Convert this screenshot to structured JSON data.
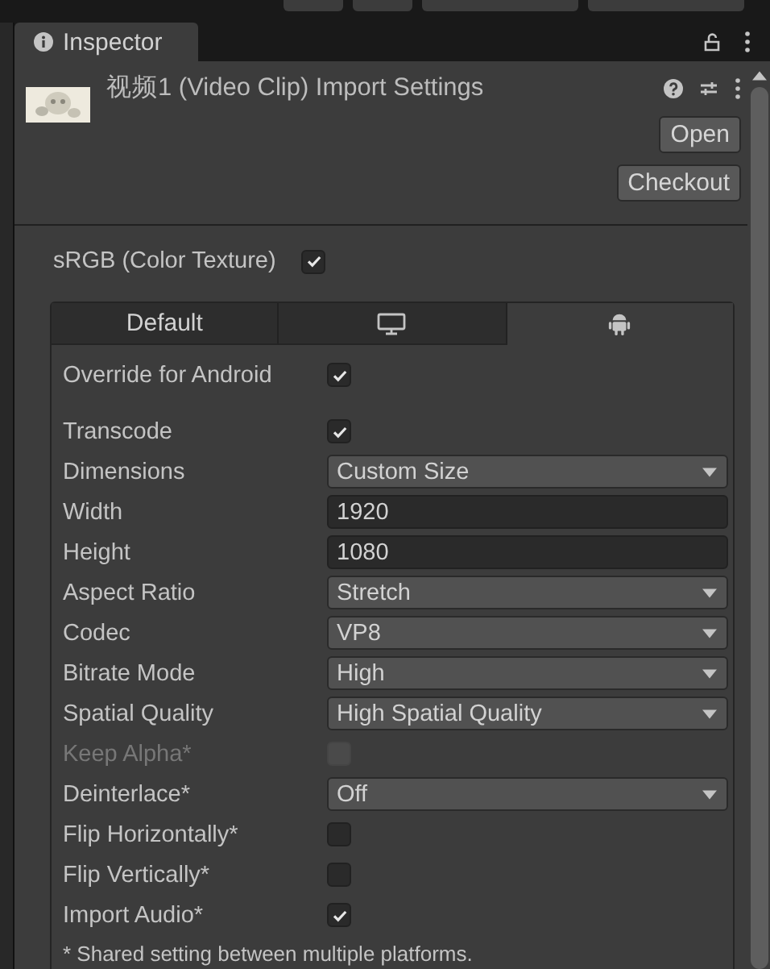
{
  "window": {
    "title": "Inspector"
  },
  "header": {
    "title": "视频1 (Video Clip) Import Settings",
    "thumbnail": {
      "kind": "picture"
    },
    "buttons": [
      "Open",
      "Checkout"
    ]
  },
  "srgb": {
    "label": "sRGB (Color Texture)",
    "checked": true
  },
  "platform_tabs": [
    {
      "kind": "text",
      "label": "Default",
      "selected": false
    },
    {
      "kind": "monitor",
      "selected": false
    },
    {
      "kind": "android",
      "selected": true
    }
  ],
  "override": {
    "label": "Override for Android",
    "checked": true
  },
  "settings": [
    {
      "kind": "checkbox",
      "label": "Transcode",
      "checked": true,
      "disabled": false
    },
    {
      "kind": "dropdown",
      "label": "Dimensions",
      "value": "Custom Size",
      "disabled": false
    },
    {
      "kind": "field",
      "label": "Width",
      "value": "1920",
      "disabled": false
    },
    {
      "kind": "field",
      "label": "Height",
      "value": "1080",
      "disabled": false
    },
    {
      "kind": "dropdown",
      "label": "Aspect Ratio",
      "value": "Stretch",
      "disabled": false
    },
    {
      "kind": "dropdown",
      "label": "Codec",
      "value": "VP8",
      "disabled": false
    },
    {
      "kind": "dropdown",
      "label": "Bitrate Mode",
      "value": "High",
      "disabled": false
    },
    {
      "kind": "dropdown",
      "label": "Spatial Quality",
      "value": "High Spatial Quality",
      "disabled": false
    },
    {
      "kind": "checkbox",
      "label": "Keep Alpha*",
      "checked": false,
      "disabled": true
    },
    {
      "kind": "dropdown",
      "label": "Deinterlace*",
      "value": "Off",
      "disabled": false
    },
    {
      "kind": "checkbox",
      "label": "Flip Horizontally*",
      "checked": false,
      "disabled": false
    },
    {
      "kind": "checkbox",
      "label": "Flip Vertically*",
      "checked": false,
      "disabled": false
    },
    {
      "kind": "checkbox",
      "label": "Import Audio*",
      "checked": true,
      "disabled": false
    }
  ],
  "footnote": "* Shared setting between multiple platforms."
}
